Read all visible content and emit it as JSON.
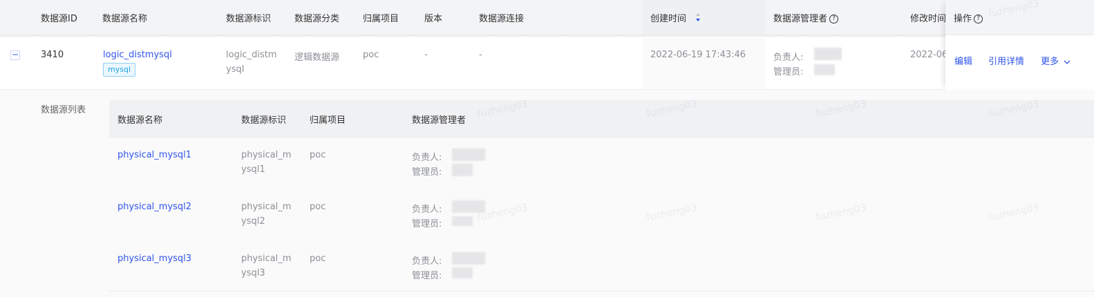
{
  "header": {
    "cols": [
      "数据源ID",
      "数据源名称",
      "数据源标识",
      "数据源分类",
      "归属项目",
      "版本",
      "数据源连接",
      "创建时间",
      "数据源管理者",
      "修改时间",
      "操作"
    ]
  },
  "row": {
    "id": "3410",
    "name": "logic_distmysql",
    "tag": "mysql",
    "identifier_line1": "logic_distm",
    "identifier_line2": "ysql",
    "category": "逻辑数据源",
    "project": "poc",
    "version": "-",
    "connection": "-",
    "created": "2022-06-19 17:43:46",
    "owner_label": "负责人:",
    "admin_label": "管理员:",
    "modified": "2022-06",
    "actions": {
      "edit": "编辑",
      "refs": "引用详情",
      "more": "更多"
    }
  },
  "sub": {
    "section_label": "数据源列表",
    "cols": [
      "数据源名称",
      "数据源标识",
      "归属项目",
      "数据源管理者"
    ],
    "rows": [
      {
        "name": "physical_mysql1",
        "id1": "physical_m",
        "id2": "ysql1",
        "project": "poc",
        "owner_label": "负责人:",
        "admin_label": "管理员:"
      },
      {
        "name": "physical_mysql2",
        "id1": "physical_m",
        "id2": "ysql2",
        "project": "poc",
        "owner_label": "负责人:",
        "admin_label": "管理员:"
      },
      {
        "name": "physical_mysql3",
        "id1": "physical_m",
        "id2": "ysql3",
        "project": "poc",
        "owner_label": "负责人:",
        "admin_label": "管理员:"
      }
    ]
  },
  "watermark": "fuzheng03",
  "colors": {
    "link": "#2f54eb",
    "header_bg": "#f3f4f6"
  }
}
